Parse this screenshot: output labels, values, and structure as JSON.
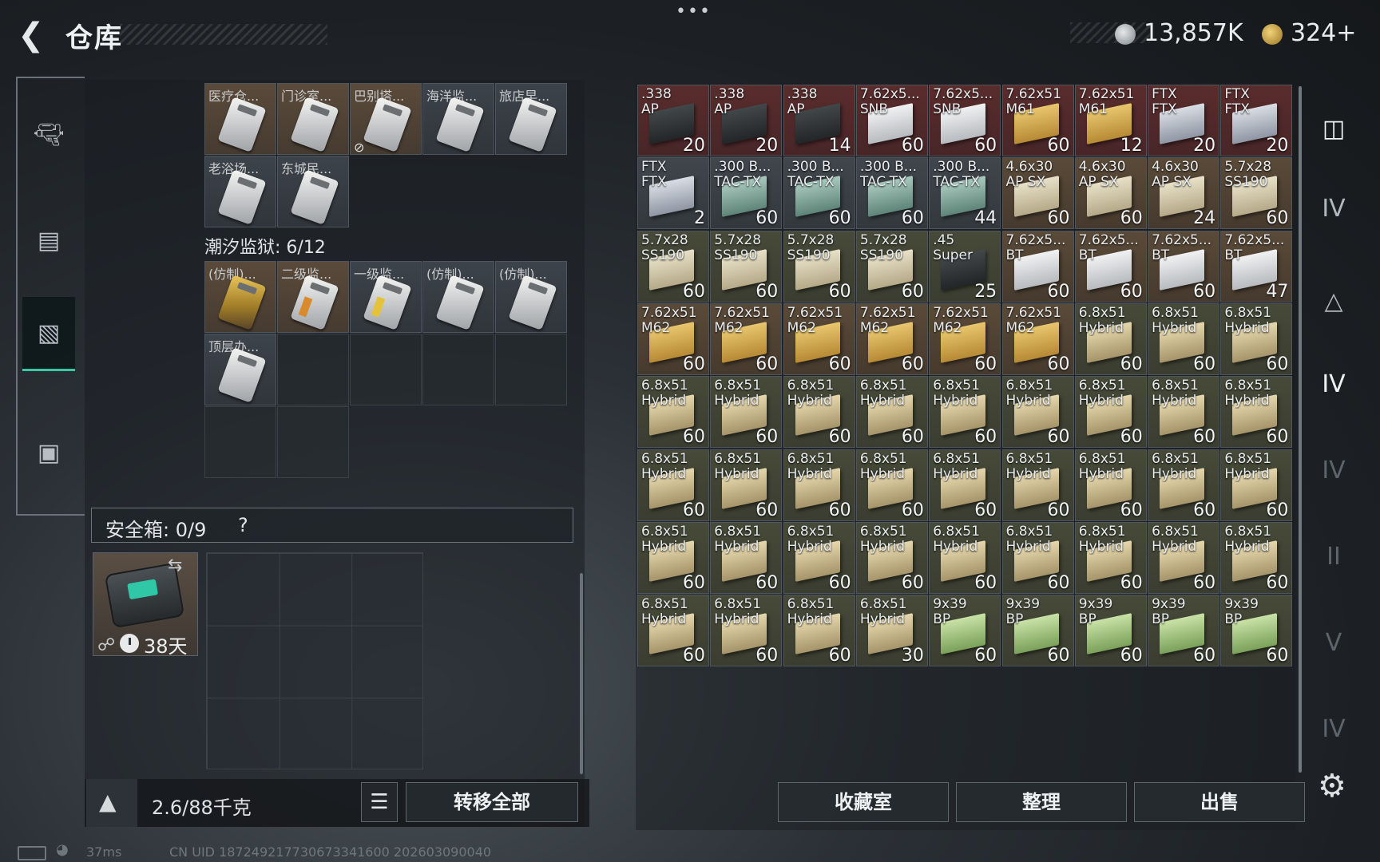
{
  "header": {
    "title": "仓库",
    "more_dots": "•••",
    "currency1": "13,857K",
    "currency2": "324+"
  },
  "left_nav": [
    "gun-icon",
    "backpack-icon",
    "container-icon",
    "briefcase-icon"
  ],
  "stash": {
    "row1": [
      "医疗仓...",
      "门诊室...",
      "巴别塔...",
      "海洋监...",
      "旅店早..."
    ],
    "row2": [
      "老浴场...",
      "东城民..."
    ],
    "section_title": "潮汐监狱: 6/12",
    "row3": [
      "(仿制)...",
      "二级监...",
      "一级监...",
      "(仿制)...",
      "(仿制)..."
    ],
    "row4": [
      "顶层办..."
    ]
  },
  "safebox": {
    "label": "安全箱: 0/9",
    "help": "?",
    "days": "38天"
  },
  "footer_left": {
    "weight": "2.6/88千克",
    "transfer_all": "转移全部"
  },
  "ammo_rows": [
    [
      {
        "name": ".338\nAP",
        "count": "20",
        "tone": "red",
        "box": "dark"
      },
      {
        "name": ".338\nAP",
        "count": "20",
        "tone": "red",
        "box": "dark"
      },
      {
        "name": ".338\nAP",
        "count": "14",
        "tone": "red",
        "box": "dark"
      },
      {
        "name": "7.62x5...\nSNB",
        "count": "60",
        "tone": "red",
        "box": "white"
      },
      {
        "name": "7.62x5...\nSNB",
        "count": "60",
        "tone": "red",
        "box": "white"
      },
      {
        "name": "7.62x51\nM61",
        "count": "60",
        "tone": "red",
        "box": "gold"
      },
      {
        "name": "7.62x51\nM61",
        "count": "12",
        "tone": "red",
        "box": "gold"
      },
      {
        "name": "FTX\nFTX",
        "count": "20",
        "tone": "red",
        "box": "silver"
      },
      {
        "name": "FTX\nFTX",
        "count": "20",
        "tone": "red",
        "box": "silver"
      }
    ],
    [
      {
        "name": "FTX\nFTX",
        "count": "2",
        "tone": "gray",
        "box": "silver"
      },
      {
        "name": ".300 B...\nTAC-TX",
        "count": "60",
        "tone": "gray",
        "box": "teal"
      },
      {
        "name": ".300 B...\nTAC-TX",
        "count": "60",
        "tone": "gray",
        "box": "teal"
      },
      {
        "name": ".300 B...\nTAC-TX",
        "count": "60",
        "tone": "gray",
        "box": "teal"
      },
      {
        "name": ".300 B...\nTAC-TX",
        "count": "44",
        "tone": "gray",
        "box": "teal"
      },
      {
        "name": "4.6x30\nAP SX",
        "count": "60",
        "tone": "brown",
        "box": "cream"
      },
      {
        "name": "4.6x30\nAP SX",
        "count": "60",
        "tone": "brown",
        "box": "cream"
      },
      {
        "name": "4.6x30\nAP SX",
        "count": "24",
        "tone": "brown",
        "box": "cream"
      },
      {
        "name": "5.7x28\nSS190",
        "count": "60",
        "tone": "brown",
        "box": "cream"
      }
    ],
    [
      {
        "name": "5.7x28\nSS190",
        "count": "60",
        "tone": "olive",
        "box": "cream"
      },
      {
        "name": "5.7x28\nSS190",
        "count": "60",
        "tone": "olive",
        "box": "cream"
      },
      {
        "name": "5.7x28\nSS190",
        "count": "60",
        "tone": "olive",
        "box": "cream"
      },
      {
        "name": "5.7x28\nSS190",
        "count": "60",
        "tone": "olive",
        "box": "cream"
      },
      {
        "name": ".45\nSuper",
        "count": "25",
        "tone": "olive",
        "box": "dark"
      },
      {
        "name": "7.62x5...\nBT",
        "count": "60",
        "tone": "brown",
        "box": "white"
      },
      {
        "name": "7.62x5...\nBT",
        "count": "60",
        "tone": "brown",
        "box": "white"
      },
      {
        "name": "7.62x5...\nBT",
        "count": "60",
        "tone": "brown",
        "box": "white"
      },
      {
        "name": "7.62x5...\nBT",
        "count": "47",
        "tone": "brown",
        "box": "white"
      }
    ],
    [
      {
        "name": "7.62x51\nM62",
        "count": "60",
        "tone": "brown",
        "box": "gold"
      },
      {
        "name": "7.62x51\nM62",
        "count": "60",
        "tone": "brown",
        "box": "gold"
      },
      {
        "name": "7.62x51\nM62",
        "count": "60",
        "tone": "brown",
        "box": "gold"
      },
      {
        "name": "7.62x51\nM62",
        "count": "60",
        "tone": "brown",
        "box": "gold"
      },
      {
        "name": "7.62x51\nM62",
        "count": "60",
        "tone": "brown",
        "box": "gold"
      },
      {
        "name": "7.62x51\nM62",
        "count": "60",
        "tone": "brown",
        "box": "gold"
      },
      {
        "name": "6.8x51\nHybrid",
        "count": "60",
        "tone": "olive",
        "box": "tan"
      },
      {
        "name": "6.8x51\nHybrid",
        "count": "60",
        "tone": "olive",
        "box": "tan"
      },
      {
        "name": "6.8x51\nHybrid",
        "count": "60",
        "tone": "olive",
        "box": "tan"
      }
    ],
    [
      {
        "name": "6.8x51\nHybrid",
        "count": "60",
        "tone": "olive",
        "box": "tan"
      },
      {
        "name": "6.8x51\nHybrid",
        "count": "60",
        "tone": "olive",
        "box": "tan"
      },
      {
        "name": "6.8x51\nHybrid",
        "count": "60",
        "tone": "olive",
        "box": "tan"
      },
      {
        "name": "6.8x51\nHybrid",
        "count": "60",
        "tone": "olive",
        "box": "tan"
      },
      {
        "name": "6.8x51\nHybrid",
        "count": "60",
        "tone": "olive",
        "box": "tan"
      },
      {
        "name": "6.8x51\nHybrid",
        "count": "60",
        "tone": "olive",
        "box": "tan"
      },
      {
        "name": "6.8x51\nHybrid",
        "count": "60",
        "tone": "olive",
        "box": "tan"
      },
      {
        "name": "6.8x51\nHybrid",
        "count": "60",
        "tone": "olive",
        "box": "tan"
      },
      {
        "name": "6.8x51\nHybrid",
        "count": "60",
        "tone": "olive",
        "box": "tan"
      }
    ],
    [
      {
        "name": "6.8x51\nHybrid",
        "count": "60",
        "tone": "olive",
        "box": "tan"
      },
      {
        "name": "6.8x51\nHybrid",
        "count": "60",
        "tone": "olive",
        "box": "tan"
      },
      {
        "name": "6.8x51\nHybrid",
        "count": "60",
        "tone": "olive",
        "box": "tan"
      },
      {
        "name": "6.8x51\nHybrid",
        "count": "60",
        "tone": "olive",
        "box": "tan"
      },
      {
        "name": "6.8x51\nHybrid",
        "count": "60",
        "tone": "olive",
        "box": "tan"
      },
      {
        "name": "6.8x51\nHybrid",
        "count": "60",
        "tone": "olive",
        "box": "tan"
      },
      {
        "name": "6.8x51\nHybrid",
        "count": "60",
        "tone": "olive",
        "box": "tan"
      },
      {
        "name": "6.8x51\nHybrid",
        "count": "60",
        "tone": "olive",
        "box": "tan"
      },
      {
        "name": "6.8x51\nHybrid",
        "count": "60",
        "tone": "olive",
        "box": "tan"
      }
    ],
    [
      {
        "name": "6.8x51\nHybrid",
        "count": "60",
        "tone": "olive",
        "box": "tan"
      },
      {
        "name": "6.8x51\nHybrid",
        "count": "60",
        "tone": "olive",
        "box": "tan"
      },
      {
        "name": "6.8x51\nHybrid",
        "count": "60",
        "tone": "olive",
        "box": "tan"
      },
      {
        "name": "6.8x51\nHybrid",
        "count": "60",
        "tone": "olive",
        "box": "tan"
      },
      {
        "name": "6.8x51\nHybrid",
        "count": "60",
        "tone": "olive",
        "box": "tan"
      },
      {
        "name": "6.8x51\nHybrid",
        "count": "60",
        "tone": "olive",
        "box": "tan"
      },
      {
        "name": "6.8x51\nHybrid",
        "count": "60",
        "tone": "olive",
        "box": "tan"
      },
      {
        "name": "6.8x51\nHybrid",
        "count": "60",
        "tone": "olive",
        "box": "tan"
      },
      {
        "name": "6.8x51\nHybrid",
        "count": "60",
        "tone": "olive",
        "box": "tan"
      }
    ],
    [
      {
        "name": "6.8x51\nHybrid",
        "count": "60",
        "tone": "olive",
        "box": "tan"
      },
      {
        "name": "6.8x51\nHybrid",
        "count": "60",
        "tone": "olive",
        "box": "tan"
      },
      {
        "name": "6.8x51\nHybrid",
        "count": "60",
        "tone": "olive",
        "box": "tan"
      },
      {
        "name": "6.8x51\nHybrid",
        "count": "30",
        "tone": "olive",
        "box": "tan"
      },
      {
        "name": "9x39\nBP",
        "count": "60",
        "tone": "olive",
        "box": "green"
      },
      {
        "name": "9x39\nBP",
        "count": "60",
        "tone": "olive",
        "box": "green"
      },
      {
        "name": "9x39\nBP",
        "count": "60",
        "tone": "olive",
        "box": "green"
      },
      {
        "name": "9x39\nBP",
        "count": "60",
        "tone": "olive",
        "box": "green"
      },
      {
        "name": "9x39\nBP",
        "count": "60",
        "tone": "olive",
        "box": "green"
      }
    ]
  ],
  "footer_right": {
    "collection": "收藏室",
    "sort": "整理",
    "sell": "出售"
  },
  "right_nav": [
    "helmet-icon",
    "IV",
    "armor-tier-icon",
    "IV",
    "IV",
    "II",
    "V",
    "IV"
  ],
  "status_bar": {
    "ping": "37ms",
    "uid": "CN UID 1872492177306733416​00 202603090040"
  }
}
